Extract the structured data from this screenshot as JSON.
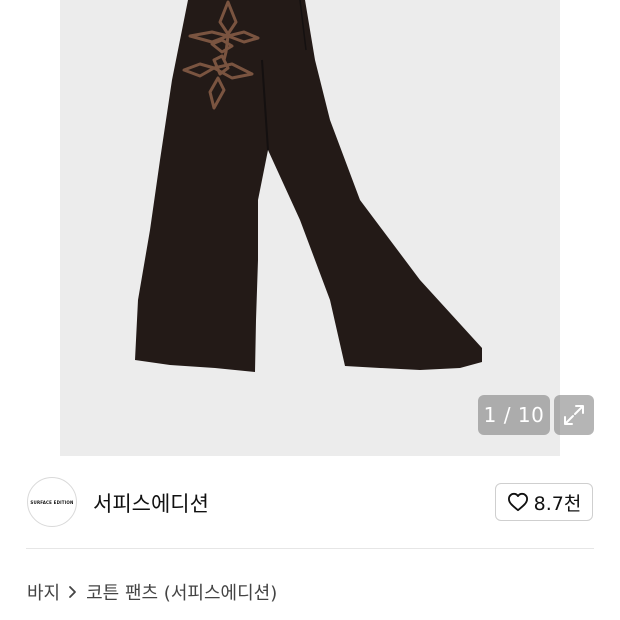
{
  "gallery": {
    "current": "1",
    "total": "10",
    "counter_text": "1 / 10",
    "expand_icon": "expand-icon"
  },
  "seller": {
    "logo_text": "SURFACE EDITION",
    "name": "서피스에디션",
    "like_icon": "heart-icon",
    "like_count": "8.7천"
  },
  "breadcrumb": {
    "category": "바지",
    "separator_icon": "chevron-right-icon",
    "product": "코튼 팬츠 (서피스에디션)"
  },
  "colors": {
    "pants": "#231a17",
    "embroidery": "#7a5440",
    "photo_bg": "#ececec"
  }
}
